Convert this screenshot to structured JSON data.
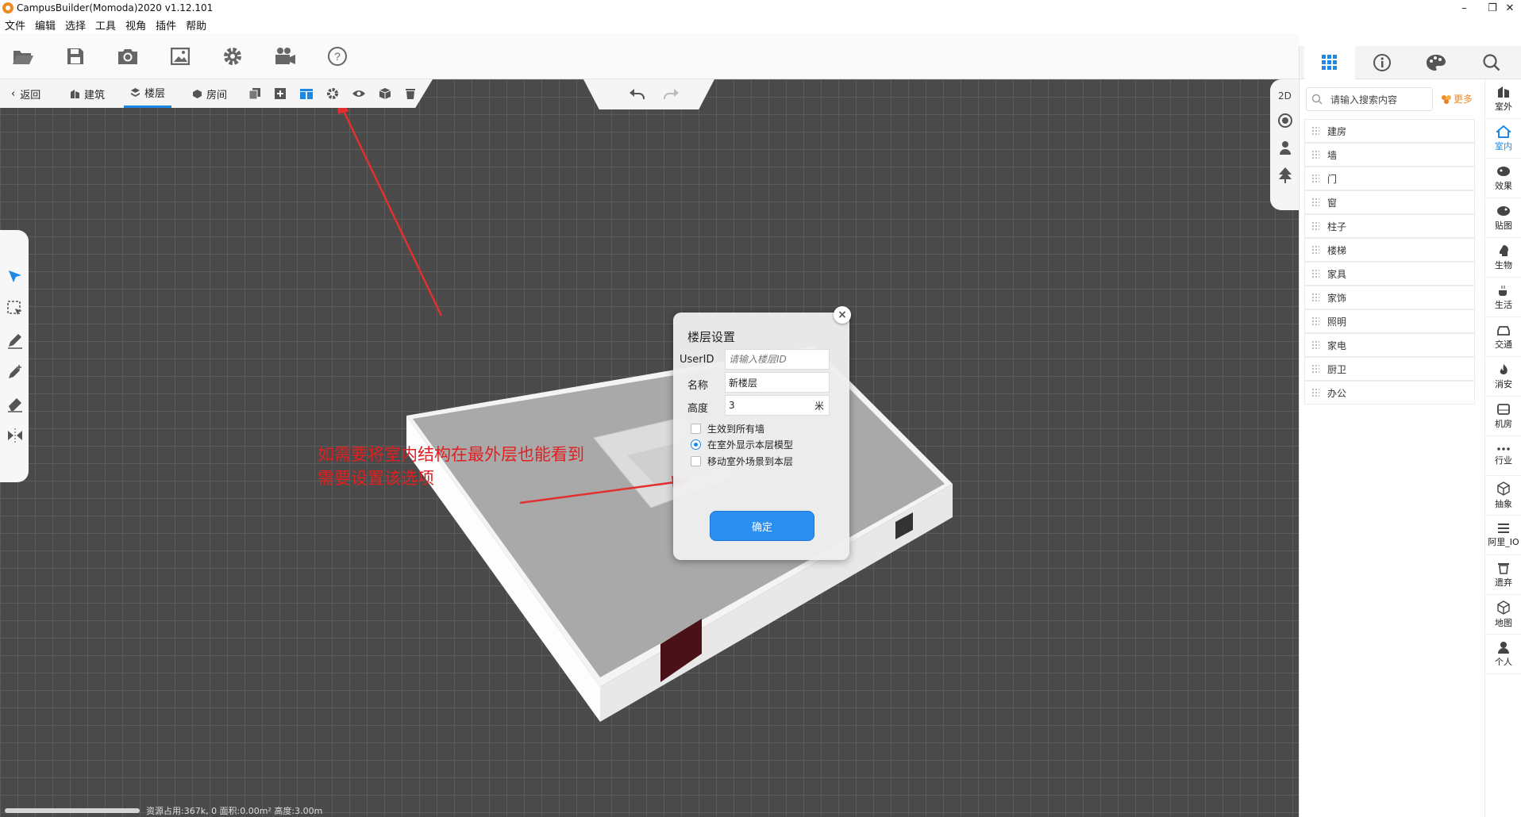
{
  "window": {
    "title": "CampusBuilder(Momoda)2020 v1.12.101",
    "minimize": "–",
    "restore": "❐",
    "close": "✕"
  },
  "menu": [
    "文件",
    "编辑",
    "选择",
    "工具",
    "视角",
    "插件",
    "帮助"
  ],
  "toolbar": {
    "icons": [
      "folder-open",
      "save",
      "camera",
      "image",
      "settings",
      "video-camera",
      "help"
    ]
  },
  "floorbar": {
    "back": "返回",
    "building": "建筑",
    "floor": "楼层",
    "room": "房间"
  },
  "view": {
    "mode_2d": "2D"
  },
  "rightpanel": {
    "search_placeholder": "请输入搜索内容",
    "more": "更多",
    "items": [
      "建房",
      "墙",
      "门",
      "窗",
      "柱子",
      "楼梯",
      "家具",
      "家饰",
      "照明",
      "家电",
      "厨卫",
      "办公"
    ]
  },
  "categories": [
    "室外",
    "室内",
    "效果",
    "贴图",
    "生物",
    "生活",
    "交通",
    "消安",
    "机房",
    "行业",
    "抽象",
    "阿里_IO",
    "遗弃",
    "地图",
    "个人"
  ],
  "status": {
    "text": "资源占用:367k, 0    面积:0.00m²    高度:3.00m"
  },
  "dialog": {
    "title": "楼层设置",
    "userid_label": "UserID",
    "userid_placeholder": "请输入楼层ID",
    "name_label": "名称",
    "name_value": "新楼层",
    "height_label": "高度",
    "height_value": "3",
    "height_unit": "米",
    "opt_all_walls": "生效到所有墙",
    "opt_show_outdoor": "在室外显示本层模型",
    "opt_move_scene": "移动室外场景到本层",
    "ok": "确定",
    "close": "×"
  },
  "annotation": {
    "line1": "如需要将室内结构在最外层也能看到",
    "line2": "需要设置该选项"
  },
  "colors": {
    "accent": "#1e88e5",
    "annotation": "#e02020",
    "more": "#f08a24"
  }
}
